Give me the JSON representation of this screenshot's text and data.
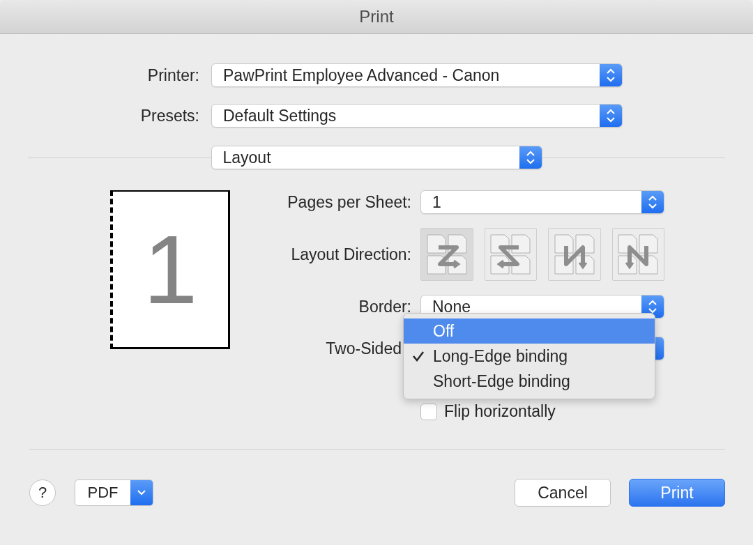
{
  "window": {
    "title": "Print"
  },
  "printer": {
    "label": "Printer:",
    "value": "PawPrint Employee Advanced - Canon"
  },
  "presets": {
    "label": "Presets:",
    "value": "Default Settings"
  },
  "section": {
    "value": "Layout"
  },
  "preview": {
    "page_number": "1"
  },
  "pages_per_sheet": {
    "label": "Pages per Sheet:",
    "value": "1"
  },
  "layout_direction": {
    "label": "Layout Direction:",
    "options": [
      {
        "kind": "z",
        "selected": true
      },
      {
        "kind": "s",
        "selected": false
      },
      {
        "kind": "n_reverse",
        "selected": false
      },
      {
        "kind": "n",
        "selected": false
      }
    ]
  },
  "border": {
    "label": "Border:",
    "value": "None"
  },
  "two_sided": {
    "label": "Two-Sided"
  },
  "two_sided_menu": {
    "items": [
      {
        "label": "Off",
        "highlighted": true,
        "checked": false
      },
      {
        "label": "Long-Edge binding",
        "highlighted": false,
        "checked": true
      },
      {
        "label": "Short-Edge binding",
        "highlighted": false,
        "checked": false
      }
    ]
  },
  "flip": {
    "label": "Flip horizontally",
    "checked": false
  },
  "footer": {
    "help": "?",
    "pdf": "PDF",
    "cancel": "Cancel",
    "print": "Print"
  }
}
